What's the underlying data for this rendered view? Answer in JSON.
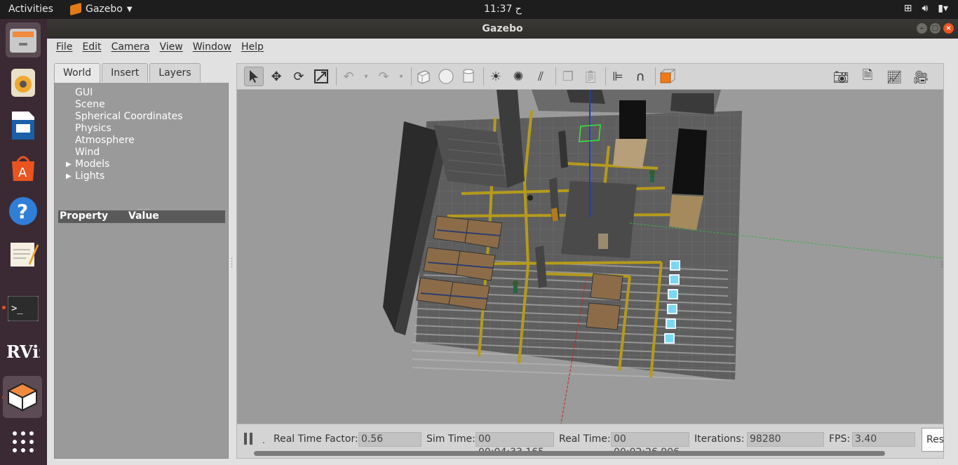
{
  "topbar": {
    "activities": "Activities",
    "app_name": "Gazebo",
    "clock": "11:37 ح"
  },
  "window": {
    "title": "Gazebo"
  },
  "menu": [
    "File",
    "Edit",
    "Camera",
    "View",
    "Window",
    "Help"
  ],
  "left_panel": {
    "tabs": [
      "World",
      "Insert",
      "Layers"
    ],
    "active_tab": "World",
    "tree": [
      {
        "label": "GUI",
        "expandable": false
      },
      {
        "label": "Scene",
        "expandable": false
      },
      {
        "label": "Spherical Coordinates",
        "expandable": false
      },
      {
        "label": "Physics",
        "expandable": false
      },
      {
        "label": "Atmosphere",
        "expandable": false
      },
      {
        "label": "Wind",
        "expandable": false
      },
      {
        "label": "Models",
        "expandable": true
      },
      {
        "label": "Lights",
        "expandable": true
      }
    ],
    "property_header": {
      "property": "Property",
      "value": "Value"
    }
  },
  "status": {
    "real_time_factor_label": "Real Time Factor:",
    "real_time_factor": "0.56",
    "sim_time_label": "Sim Time:",
    "sim_time": "00 00:04:33.165",
    "real_time_label": "Real Time:",
    "real_time": "00 00:02:26.906",
    "iterations_label": "Iterations:",
    "iterations": "98280",
    "fps_label": "FPS:",
    "fps": "3.40",
    "reset_label": "Res"
  },
  "colors": {
    "accent": "#e95420",
    "dock_bg": "#3b2a34",
    "floor_line": "#b59a1c",
    "scene_bg": "#9b9b9b"
  }
}
